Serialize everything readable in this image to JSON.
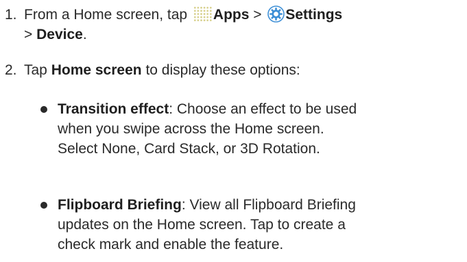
{
  "steps": [
    {
      "number": "1.",
      "line1_prefix": "From a Home screen, tap ",
      "apps_label": "Apps",
      "sep1": " > ",
      "settings_label": "Settings",
      "line2_sep": "> ",
      "device_label": "Device",
      "line2_end": "."
    },
    {
      "number": "2.",
      "prefix": "Tap ",
      "home_screen_label": "Home screen",
      "suffix": " to display these options:"
    }
  ],
  "options": [
    {
      "title": "Transition effect",
      "line1_rest": ": Choose an effect to be used",
      "line2": "when you swipe across the Home screen.",
      "line3": "Select None, Card Stack, or 3D Rotation."
    },
    {
      "title": "Flipboard Briefing",
      "line1_rest": ": View all Flipboard Briefing",
      "line2": "updates on the Home screen. Tap to create a",
      "line3": "check mark and enable the feature."
    }
  ],
  "icons": {
    "apps": "apps-grid-icon",
    "settings": "settings-gear-icon"
  },
  "colors": {
    "text": "#2a2a2a",
    "apps_icon_dots": "#d6cf8a",
    "settings_icon_blue": "#3d8fd6"
  }
}
